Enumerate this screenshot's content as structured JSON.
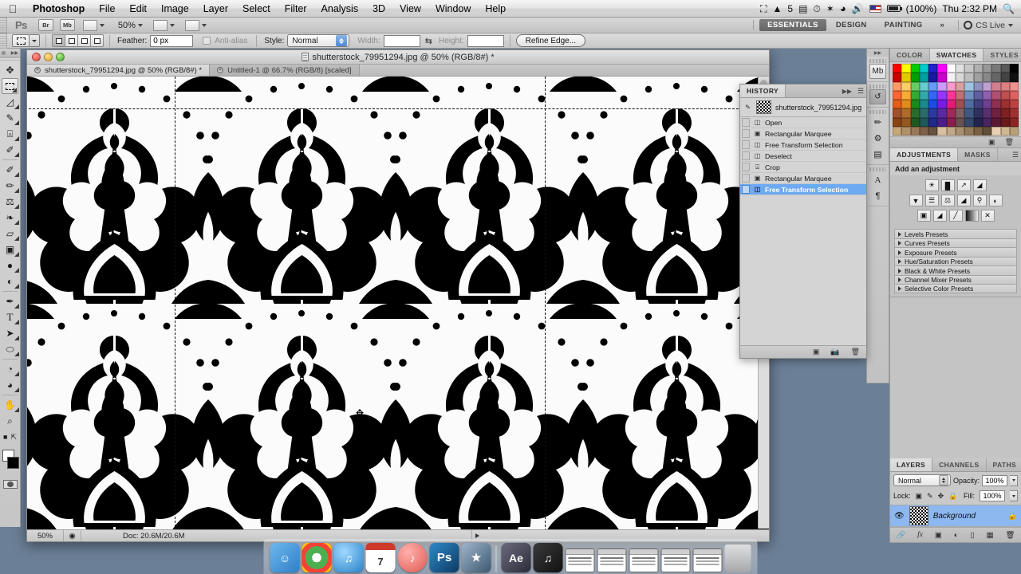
{
  "macmenu": {
    "apple_icon": "apple-icon",
    "items": [
      "Photoshop",
      "File",
      "Edit",
      "Image",
      "Layer",
      "Select",
      "Filter",
      "Analysis",
      "3D",
      "View",
      "Window",
      "Help"
    ],
    "status": {
      "screencast_icon": "screencast-icon",
      "notifier_label": "5",
      "scanner_icon": "scanner-icon",
      "clock_icon": "clock-icon",
      "bluetooth_icon": "bluetooth-icon",
      "wifi_icon": "wifi-icon",
      "volume_icon": "volume-icon",
      "flag_icon": "us-flag-icon",
      "battery_icon": "battery-icon",
      "battery_percent": "(100%)",
      "time": "Thu 2:32 PM",
      "spotlight_icon": "search-icon"
    }
  },
  "appbar": {
    "logo": "Ps",
    "bridge_label": "Br",
    "minibridge_label": "Mb",
    "view_extras_icon": "view-extras-icon",
    "zoom_level": "50%",
    "screen_mode_icon": "arrange-documents-icon",
    "screen_mode2_icon": "screen-mode-icon",
    "workspaces": [
      {
        "label": "ESSENTIALS",
        "active": true
      },
      {
        "label": "DESIGN",
        "active": false
      },
      {
        "label": "PAINTING",
        "active": false
      }
    ],
    "more_workspaces": "»",
    "cs_live": "CS Live"
  },
  "optionsbar": {
    "tool_icon": "rectangular-marquee-icon",
    "selection_modes": [
      "new-selection",
      "add-to-selection",
      "subtract-from-selection",
      "intersect-selection"
    ],
    "feather_label": "Feather:",
    "feather_value": "0 px",
    "antialias_label": "Anti-alias",
    "style_label": "Style:",
    "style_value": "Normal",
    "width_label": "Width:",
    "width_value": "",
    "swap_icon": "swap-dimensions-icon",
    "height_label": "Height:",
    "height_value": "",
    "refine_edge": "Refine Edge..."
  },
  "toolbox": {
    "tools": [
      {
        "name": "move-tool",
        "glyph": "✥"
      },
      {
        "name": "rectangular-marquee-tool",
        "glyph": "",
        "selected": true
      },
      {
        "name": "lasso-tool",
        "glyph": "☄"
      },
      {
        "name": "quick-selection-tool",
        "glyph": "✎"
      },
      {
        "name": "crop-tool",
        "glyph": "⌗"
      },
      {
        "name": "eyedropper-tool",
        "glyph": "✒"
      },
      {
        "name": "spot-healing-brush-tool",
        "glyph": "✐"
      },
      {
        "name": "brush-tool",
        "glyph": "✏"
      },
      {
        "name": "clone-stamp-tool",
        "glyph": "⚓"
      },
      {
        "name": "history-brush-tool",
        "glyph": "❧"
      },
      {
        "name": "eraser-tool",
        "glyph": "▱"
      },
      {
        "name": "gradient-tool",
        "glyph": "▣"
      },
      {
        "name": "blur-tool",
        "glyph": "●"
      },
      {
        "name": "dodge-tool",
        "glyph": "◐"
      },
      {
        "name": "pen-tool",
        "glyph": "✒"
      },
      {
        "name": "type-tool",
        "glyph": "T"
      },
      {
        "name": "path-selection-tool",
        "glyph": "➤"
      },
      {
        "name": "ellipse-shape-tool",
        "glyph": "○"
      },
      {
        "name": "3d-rotate-tool",
        "glyph": "◔"
      },
      {
        "name": "3d-orbit-tool",
        "glyph": "◕"
      },
      {
        "name": "hand-tool",
        "glyph": "✋"
      },
      {
        "name": "zoom-tool",
        "glyph": "⌕"
      }
    ],
    "foreground_color": "#ffffff",
    "background_color": "#000000",
    "quickmask_icon": "quick-mask-icon"
  },
  "document": {
    "window_title": "shutterstock_79951294.jpg @ 50% (RGB/8#) *",
    "tabs": [
      {
        "label": "shutterstock_79951294.jpg @ 50% (RGB/8#) *",
        "active": true
      },
      {
        "label": "Untitled-1 @ 66.7% (RGB/8) [scaled]",
        "active": false
      }
    ],
    "statusbar": {
      "zoom": "50%",
      "doc_info": "Doc: 20.6M/20.6M"
    }
  },
  "history": {
    "tab_label": "HISTORY",
    "snapshot": "shutterstock_79951294.jpg",
    "states": [
      {
        "label": "Open",
        "icon": "open-icon",
        "selected": false
      },
      {
        "label": "Rectangular Marquee",
        "icon": "marquee-icon",
        "selected": false
      },
      {
        "label": "Free Transform Selection",
        "icon": "transform-icon",
        "selected": false
      },
      {
        "label": "Deselect",
        "icon": "deselect-icon",
        "selected": false
      },
      {
        "label": "Crop",
        "icon": "crop-icon",
        "selected": false
      },
      {
        "label": "Rectangular Marquee",
        "icon": "marquee-icon",
        "selected": false
      },
      {
        "label": "Free Transform Selection",
        "icon": "transform-icon",
        "selected": true
      }
    ],
    "footer_icons": [
      "new-document-from-state-icon",
      "new-snapshot-icon",
      "delete-icon"
    ]
  },
  "iconstrip": {
    "groups": [
      [
        "mini-bridge-icon"
      ],
      [
        "history-icon"
      ],
      [
        "brush-icon",
        "clone-source-icon",
        "tool-presets-icon"
      ],
      [
        "character-icon",
        "paragraph-icon"
      ]
    ]
  },
  "swatches": {
    "tabs": [
      {
        "label": "COLOR",
        "active": false
      },
      {
        "label": "SWATCHES",
        "active": true
      },
      {
        "label": "STYLES",
        "active": false
      }
    ],
    "footer_icons": [
      "new-swatch-icon",
      "delete-swatch-icon"
    ],
    "colors": [
      "#ff0000",
      "#ffff00",
      "#00cc00",
      "#00cccc",
      "#2222cc",
      "#ff00ff",
      "#ffffff",
      "#e0e0e0",
      "#c8c8c8",
      "#b0b0b0",
      "#989898",
      "#787878",
      "#585858",
      "#000000",
      "#cc0000",
      "#e6c800",
      "#00a000",
      "#00a0a0",
      "#1818a0",
      "#cc00cc",
      "#f2f2f2",
      "#d8d8d8",
      "#bdbdbd",
      "#a0a0a0",
      "#888888",
      "#666666",
      "#444444",
      "#111111",
      "#ff9966",
      "#ffcc66",
      "#66cc66",
      "#66cccc",
      "#6699ff",
      "#cc99ff",
      "#ff99cc",
      "#d9a0a0",
      "#a0c4e0",
      "#9090c0",
      "#c0a0d0",
      "#d08090",
      "#e08080",
      "#f09090",
      "#ff6633",
      "#ffaa33",
      "#33aa33",
      "#33aaaa",
      "#3366ff",
      "#9933ff",
      "#ff3399",
      "#c07070",
      "#7090c0",
      "#6060a0",
      "#9060b0",
      "#b05070",
      "#c05050",
      "#e06060",
      "#e65c1a",
      "#e68a1a",
      "#1a8a1a",
      "#1a8a8a",
      "#1a4ce6",
      "#7a1ae6",
      "#e61a7a",
      "#a05050",
      "#506fa0",
      "#404080",
      "#704090",
      "#903050",
      "#a03030",
      "#c04040",
      "#a0522d",
      "#b06b2a",
      "#2a6b2a",
      "#2a6b6b",
      "#2a3aa0",
      "#5a2aa0",
      "#a02a5a",
      "#806060",
      "#405880",
      "#303060",
      "#583070",
      "#702040",
      "#802020",
      "#a03030",
      "#8b4513",
      "#96581f",
      "#1f581f",
      "#1f5858",
      "#1f2a8b",
      "#4a1f8b",
      "#8b1f4a",
      "#6b5050",
      "#34486b",
      "#242450",
      "#482560",
      "#5b1a34",
      "#6b1a1a",
      "#8b2525",
      "#c8a878",
      "#b09068",
      "#987858",
      "#806048",
      "#685040",
      "#d8c0a0",
      "#c0a888",
      "#a89070",
      "#907858",
      "#786040",
      "#605038",
      "#e8d0b0",
      "#d0b890",
      "#b8a078"
    ]
  },
  "adjustments": {
    "tabs": [
      {
        "label": "ADJUSTMENTS",
        "active": true
      },
      {
        "label": "MASKS",
        "active": false
      }
    ],
    "prompt": "Add an adjustment",
    "buttons_row1": [
      "brightness-contrast-icon",
      "levels-icon",
      "curves-icon",
      "exposure-icon"
    ],
    "buttons_row2": [
      "vibrance-icon",
      "hue-saturation-icon",
      "color-balance-icon",
      "black-white-icon",
      "photo-filter-icon",
      "channel-mixer-icon"
    ],
    "buttons_row3": [
      "invert-icon",
      "posterize-icon",
      "threshold-icon",
      "gradient-map-icon",
      "selective-color-icon"
    ],
    "presets": [
      "Levels Presets",
      "Curves Presets",
      "Exposure Presets",
      "Hue/Saturation Presets",
      "Black & White Presets",
      "Channel Mixer Presets",
      "Selective Color Presets"
    ]
  },
  "layers": {
    "tabs": [
      {
        "label": "LAYERS",
        "active": true
      },
      {
        "label": "CHANNELS",
        "active": false
      },
      {
        "label": "PATHS",
        "active": false
      }
    ],
    "blend_mode": "Normal",
    "opacity_label": "Opacity:",
    "opacity_value": "100%",
    "lock_label": "Lock:",
    "lock_icons": [
      "lock-transparent-pixels-icon",
      "lock-image-pixels-icon",
      "lock-position-icon",
      "lock-all-icon"
    ],
    "fill_label": "Fill:",
    "fill_value": "100%",
    "items": [
      {
        "name": "Background",
        "visible": true,
        "locked": true,
        "selected": true
      }
    ],
    "footer_icons": [
      "link-layers-icon",
      "layer-style-icon",
      "layer-mask-icon",
      "adjustment-layer-icon",
      "new-group-icon",
      "new-layer-icon",
      "delete-layer-icon"
    ]
  },
  "macdock": {
    "items": [
      {
        "name": "finder-icon",
        "label": "",
        "color": "#3a8fd4"
      },
      {
        "name": "chrome-icon",
        "label": "",
        "color": "#dd4b3e"
      },
      {
        "name": "itunes-icon",
        "label": "",
        "color": "#4aa3e0"
      },
      {
        "name": "calendar-icon",
        "label": "7",
        "color": "#ffffff"
      },
      {
        "name": "lastfm-icon",
        "label": "",
        "color": "#f07a7a"
      },
      {
        "name": "photoshop-icon",
        "label": "Ps",
        "color": "#1b5e8c"
      },
      {
        "name": "imovie-icon",
        "label": "",
        "color": "#4d6a86"
      },
      {
        "name": "after-effects-icon",
        "label": "Ae",
        "color": "#4a4a58"
      },
      {
        "name": "music-icon",
        "label": "",
        "color": "#1c1c1c"
      },
      {
        "name": "minimized-window-1",
        "label": "",
        "color": "#ffffff"
      },
      {
        "name": "minimized-window-2",
        "label": "",
        "color": "#ffffff"
      },
      {
        "name": "minimized-window-3",
        "label": "",
        "color": "#ffffff"
      },
      {
        "name": "minimized-window-4",
        "label": "",
        "color": "#ffffff"
      },
      {
        "name": "minimized-window-5",
        "label": "",
        "color": "#ffffff"
      },
      {
        "name": "trash-icon",
        "label": "",
        "color": "#cccccc"
      }
    ]
  },
  "colors": {
    "selection_highlight": "#6eaaf2",
    "desktop": "#6b7f96",
    "canvas_bg": "#fbfbfb",
    "pattern_fg": "#000000"
  }
}
